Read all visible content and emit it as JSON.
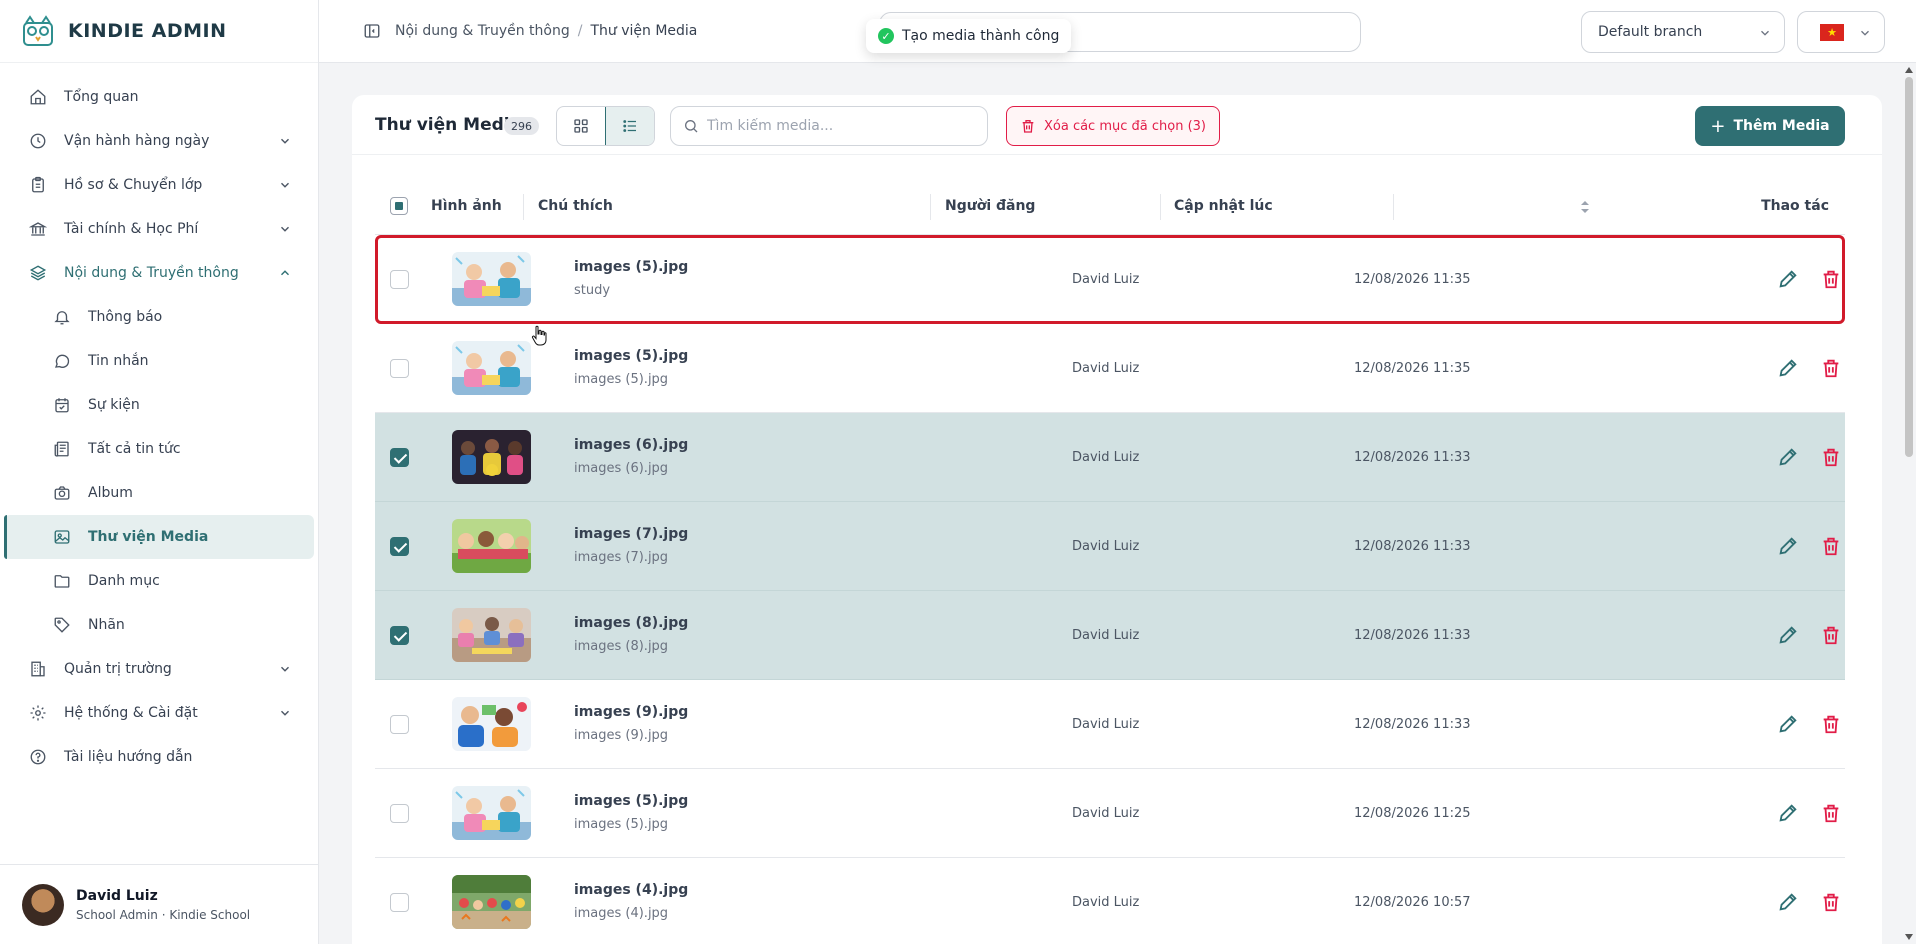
{
  "app": {
    "brand": "KINDIE ADMIN"
  },
  "sidebar": {
    "items": [
      {
        "label": "Tổng quan",
        "icon": "home-icon"
      },
      {
        "label": "Vận hành hàng ngày",
        "icon": "clock-icon"
      },
      {
        "label": "Hồ sơ & Chuyển lớp",
        "icon": "clipboard-icon"
      },
      {
        "label": "Tài chính & Học Phí",
        "icon": "bank-icon"
      },
      {
        "label": "Nội dung & Truyền thông",
        "icon": "layers-icon"
      },
      {
        "label": "Quản trị trường",
        "icon": "building-icon"
      },
      {
        "label": "Hệ thống & Cài đặt",
        "icon": "gear-icon"
      },
      {
        "label": "Tài liệu hướng dẫn",
        "icon": "help-circle-icon"
      }
    ],
    "sub_items": [
      {
        "label": "Thông báo",
        "icon": "bell-icon"
      },
      {
        "label": "Tin nhắn",
        "icon": "chat-icon"
      },
      {
        "label": "Sự kiện",
        "icon": "calendar-icon"
      },
      {
        "label": "Tất cả tin tức",
        "icon": "newspaper-icon"
      },
      {
        "label": "Album",
        "icon": "camera-icon"
      },
      {
        "label": "Thư viện Media",
        "icon": "image-icon"
      },
      {
        "label": "Danh mục",
        "icon": "folder-icon"
      },
      {
        "label": "Nhãn",
        "icon": "tag-icon"
      }
    ],
    "user": {
      "name": "David Luiz",
      "role": "School Admin · Kindie School"
    }
  },
  "header": {
    "breadcrumb": [
      "Nội dung & Truyền thông",
      "Thư viện Media"
    ],
    "breadcrumb_sep": "/",
    "branch": "Default branch",
    "language_flag": "vn-flag-icon"
  },
  "toast": {
    "message": "Tạo media thành công"
  },
  "media": {
    "title": "Thư viện Media",
    "count": "296",
    "search_placeholder": "Tìm kiếm media...",
    "delete_selected_label": "Xóa các mục đã chọn (3)",
    "add_label": "Thêm Media",
    "columns": {
      "image": "Hình ảnh",
      "caption": "Chú thích",
      "author": "Người đăng",
      "updated": "Cập nhật lúc",
      "actions": "Thao tác"
    },
    "rows": [
      {
        "file": "images (5).jpg",
        "caption": "study",
        "author": "David Luiz",
        "updated": "12/08/2026 11:35",
        "checked": false,
        "thumb": "kids-reading"
      },
      {
        "file": "images (5).jpg",
        "caption": "images (5).jpg",
        "author": "David Luiz",
        "updated": "12/08/2026 11:35",
        "checked": false,
        "thumb": "kids-reading"
      },
      {
        "file": "images (6).jpg",
        "caption": "images (6).jpg",
        "author": "David Luiz",
        "updated": "12/08/2026 11:33",
        "checked": true,
        "thumb": "kids-dark"
      },
      {
        "file": "images (7).jpg",
        "caption": "images (7).jpg",
        "author": "David Luiz",
        "updated": "12/08/2026 11:33",
        "checked": true,
        "thumb": "kids-grass"
      },
      {
        "file": "images (8).jpg",
        "caption": "images (8).jpg",
        "author": "David Luiz",
        "updated": "12/08/2026 11:33",
        "checked": true,
        "thumb": "kids-table"
      },
      {
        "file": "images (9).jpg",
        "caption": "images (9).jpg",
        "author": "David Luiz",
        "updated": "12/08/2026 11:33",
        "checked": false,
        "thumb": "kids-blue"
      },
      {
        "file": "images (5).jpg",
        "caption": "images (5).jpg",
        "author": "David Luiz",
        "updated": "12/08/2026 11:25",
        "checked": false,
        "thumb": "kids-reading"
      },
      {
        "file": "images (4).jpg",
        "caption": "images (4).jpg",
        "author": "David Luiz",
        "updated": "12/08/2026 10:57",
        "checked": false,
        "thumb": "kids-outdoor"
      }
    ]
  },
  "colors": {
    "primary": "#2f6f73",
    "danger": "#e11d48",
    "selected_row": "#d2e1e2",
    "highlight_outline": "#d11a2a",
    "success": "#22c55e"
  }
}
